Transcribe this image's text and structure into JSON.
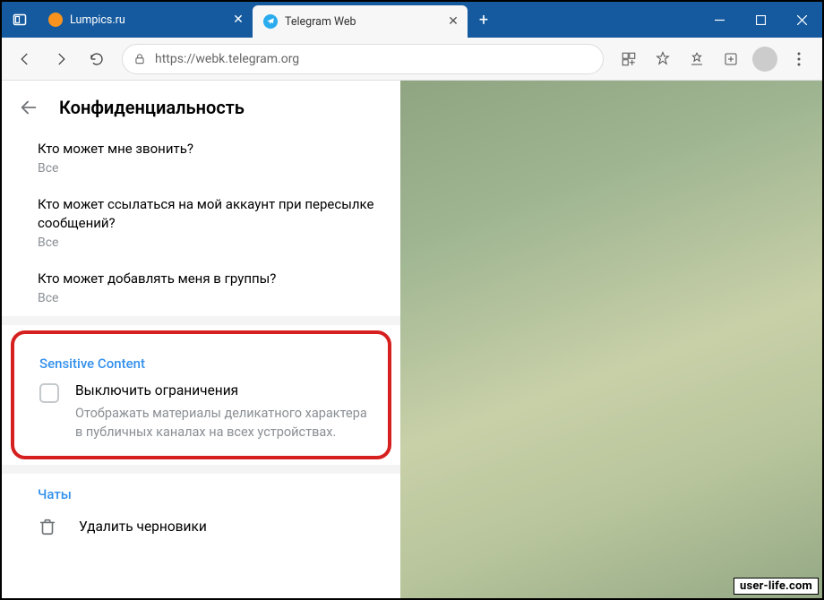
{
  "window": {
    "tabs": [
      {
        "title": "Lumpics.ru",
        "favicon_color": "#f7931e",
        "active": false
      },
      {
        "title": "Telegram Web",
        "favicon_color": "#2aabee",
        "active": true
      }
    ],
    "url": "https://webk.telegram.org"
  },
  "panel": {
    "title": "Конфиденциальность",
    "items": [
      {
        "label": "Кто может мне звонить?",
        "value": "Все"
      },
      {
        "label": "Кто может ссылаться на мой аккаунт при пересылке сообщений?",
        "value": "Все"
      },
      {
        "label": "Кто может добавлять меня в группы?",
        "value": "Все"
      }
    ],
    "sensitive": {
      "title": "Sensitive Content",
      "toggle_label": "Выключить ограничения",
      "toggle_desc": "Отображать материалы деликатного характера в публичных каналах на всех устройствах.",
      "checked": false
    },
    "chats": {
      "title": "Чаты",
      "delete_drafts": "Удалить черновики"
    }
  },
  "watermark": "user-life.com"
}
